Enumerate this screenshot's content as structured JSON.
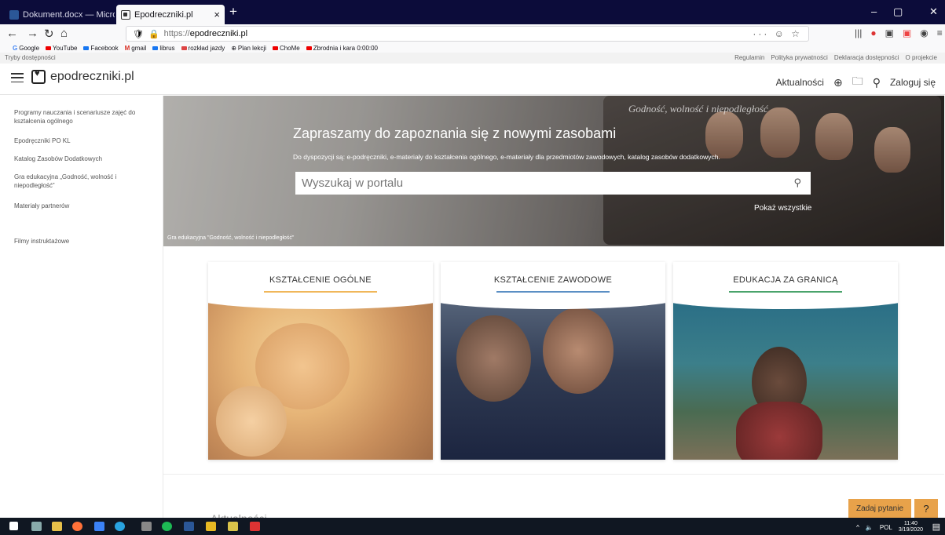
{
  "browser": {
    "tabs": [
      {
        "label": "Dokument.docx — Microsoft",
        "active": false
      },
      {
        "label": "Epodreczniki.pl",
        "active": true
      }
    ],
    "new_tab_symbol": "+",
    "close_symbol": "×",
    "url": {
      "protocol": "https://",
      "host": "epodreczniki.pl"
    },
    "url_right_icons": "··· ☺ ☆",
    "window_controls": [
      "–",
      "▢",
      "✕"
    ],
    "bookmarks": [
      {
        "label": "Google",
        "icon": "google-icon"
      },
      {
        "label": "YouTube",
        "icon": "youtube-icon"
      },
      {
        "label": "Facebook",
        "icon": "facebook-icon"
      },
      {
        "label": "gmail",
        "icon": "gmail-icon"
      },
      {
        "label": "librus",
        "icon": "librus-icon"
      },
      {
        "label": "rozkład jazdy",
        "icon": "bus-icon"
      },
      {
        "label": "Plan lekcji",
        "icon": "globe-icon"
      },
      {
        "label": "ChoMe",
        "icon": "youtube-icon"
      },
      {
        "label": "Zbrodnia i kara 0:00:00",
        "icon": "youtube-icon"
      }
    ]
  },
  "utility": {
    "accessibility": "Tryby dostępności",
    "links": [
      "Regulamin",
      "Polityka prywatności",
      "Deklaracja dostępności",
      "O projekcie"
    ]
  },
  "header": {
    "site_name": "epodreczniki.pl",
    "news": "Aktualności",
    "login": "Zaloguj się"
  },
  "sidebar": {
    "items": [
      "Programy nauczania i scenariusze zajęć do kształcenia ogólnego",
      "Epodręczniki PO KL",
      "Katalog Zasobów Dodatkowych",
      "Gra edukacyjna „Godność, wolność i niepodległość”",
      "Materiały partnerów",
      "Filmy instruktażowe"
    ]
  },
  "hero": {
    "title": "Zapraszamy do zapoznania się z nowymi zasobami",
    "subtitle": "Do dyspozycji są: e-podręczniki, e-materiały do kształcenia ogólnego, e-materiały dla przedmiotów zawodowych, katalog zasobów dodatkowych.",
    "search_placeholder": "Wyszukaj w portalu",
    "show_all": "Pokaż wszystkie",
    "caption": "Gra edukacyjna \"Godność, wolność i niepodległość\"",
    "book_title": "Godność, wolność i niepodległość"
  },
  "cards": [
    {
      "title": "KSZTAŁCENIE OGÓLNE",
      "accent": "#f0b75a"
    },
    {
      "title": "KSZTAŁCENIE ZAWODOWE",
      "accent": "#5b8fc4"
    },
    {
      "title": "EDUKACJA ZA GRANICĄ",
      "accent": "#4aa36b"
    }
  ],
  "lower": {
    "section_heading_partial": "Aktualności"
  },
  "help": {
    "ask_label": "Zadaj pytanie",
    "help_symbol": "?"
  },
  "taskbar": {
    "language": "POL",
    "time": "11:40",
    "date": "3/19/2020"
  },
  "colors": {
    "tabbar_bg": "#0c0c3a",
    "taskbar_bg": "#101722",
    "help_button": "#e8a24a"
  }
}
